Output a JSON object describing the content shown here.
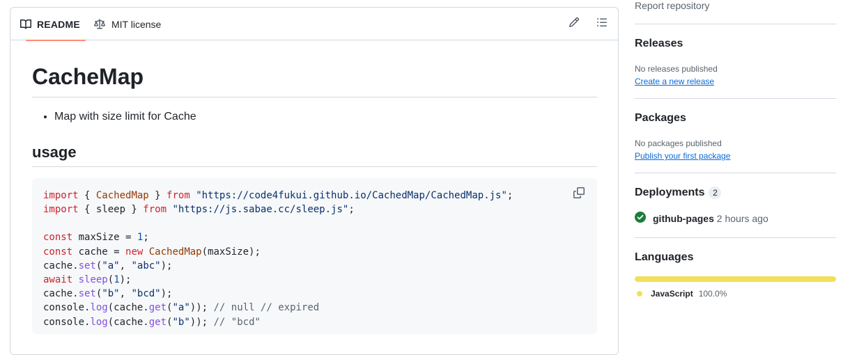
{
  "readme": {
    "tabs": [
      {
        "label": "README",
        "icon": "book-icon"
      },
      {
        "label": "MIT license",
        "icon": "law-icon"
      }
    ],
    "title": "CacheMap",
    "bullets": [
      "Map with size limit for Cache"
    ],
    "section_heading": "usage",
    "code": [
      "import { CachedMap } from \"https://code4fukui.github.io/CachedMap/CachedMap.js\";",
      "import { sleep } from \"https://js.sabae.cc/sleep.js\";",
      "",
      "const maxSize = 1;",
      "const cache = new CachedMap(maxSize);",
      "cache.set(\"a\", \"abc\");",
      "await sleep(1);",
      "cache.set(\"b\", \"bcd\");",
      "console.log(cache.get(\"a\")); // null // expired",
      "console.log(cache.get(\"b\")); // \"bcd\""
    ]
  },
  "sidebar": {
    "report_label": "Report repository",
    "releases": {
      "heading": "Releases",
      "meta": "No releases published",
      "link": "Create a new release"
    },
    "packages": {
      "heading": "Packages",
      "meta": "No packages published",
      "link": "Publish your first package"
    },
    "deployments": {
      "heading": "Deployments",
      "count": "2",
      "name": "github-pages",
      "time": "2 hours ago",
      "status_color": "#1a7f37"
    },
    "languages": {
      "heading": "Languages",
      "items": [
        {
          "name": "JavaScript",
          "percent": "100.0%",
          "color": "#f1e05a"
        }
      ]
    }
  },
  "colors": {
    "accent_tab_underline": "#fd8c73",
    "link": "#0969da",
    "border": "#d1d9e0"
  }
}
